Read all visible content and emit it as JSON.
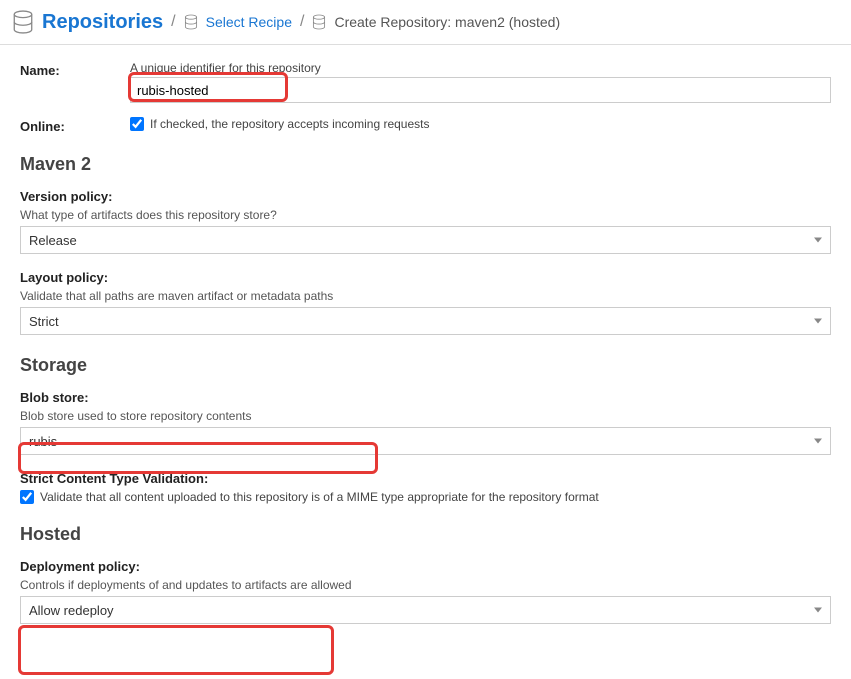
{
  "breadcrumb": {
    "root": "Repositories",
    "link": "Select Recipe",
    "current": "Create Repository: maven2 (hosted)"
  },
  "name": {
    "label": "Name:",
    "hint": "A unique identifier for this repository",
    "value": "rubis-hosted"
  },
  "online": {
    "label": "Online:",
    "checked": true,
    "text": "If checked, the repository accepts incoming requests"
  },
  "sections": {
    "maven2": {
      "title": "Maven 2",
      "versionPolicy": {
        "label": "Version policy:",
        "hint": "What type of artifacts does this repository store?",
        "value": "Release"
      },
      "layoutPolicy": {
        "label": "Layout policy:",
        "hint": "Validate that all paths are maven artifact or metadata paths",
        "value": "Strict"
      }
    },
    "storage": {
      "title": "Storage",
      "blobStore": {
        "label": "Blob store:",
        "hint": "Blob store used to store repository contents",
        "value": "rubis"
      },
      "strictValidation": {
        "label": "Strict Content Type Validation:",
        "checked": true,
        "text": "Validate that all content uploaded to this repository is of a MIME type appropriate for the repository format"
      }
    },
    "hosted": {
      "title": "Hosted",
      "deploymentPolicy": {
        "label": "Deployment policy:",
        "hint": "Controls if deployments of and updates to artifacts are allowed",
        "value": "Allow redeploy"
      }
    }
  }
}
